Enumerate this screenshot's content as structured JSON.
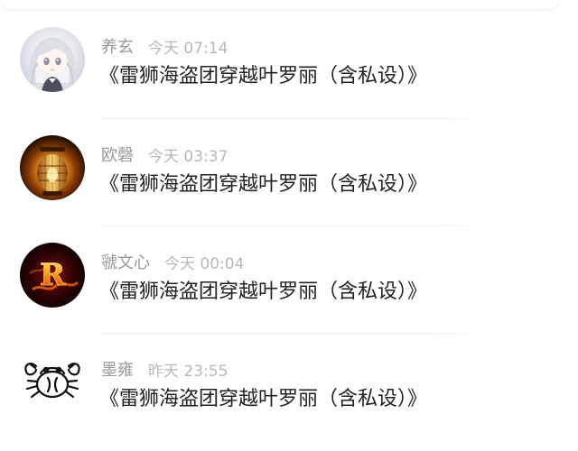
{
  "feed": {
    "items": [
      {
        "user": "养玄",
        "time": "今天 07:14",
        "content": "《雷狮海盗团穿越叶罗丽（含私设）》",
        "avatar_icon": "anime-girl-avatar-icon"
      },
      {
        "user": "欧磬",
        "time": "今天 03:37",
        "content": "《雷狮海盗团穿越叶罗丽（含私设）》",
        "avatar_icon": "lantern-avatar-icon"
      },
      {
        "user": "虢文心",
        "time": "今天 00:04",
        "content": "《雷狮海盗团穿越叶罗丽（含私设）》",
        "avatar_icon": "fire-letter-r-avatar-icon"
      },
      {
        "user": "墨雍",
        "time": "昨天 23:55",
        "content": "《雷狮海盗团穿越叶罗丽（含私设）》",
        "avatar_icon": "crab-avatar-icon"
      }
    ]
  },
  "avatar_letter": "R",
  "colors": {
    "username": "#999999",
    "time": "#b8b8b8",
    "content": "#222222",
    "divider": "#ededed",
    "background": "#ffffff"
  }
}
